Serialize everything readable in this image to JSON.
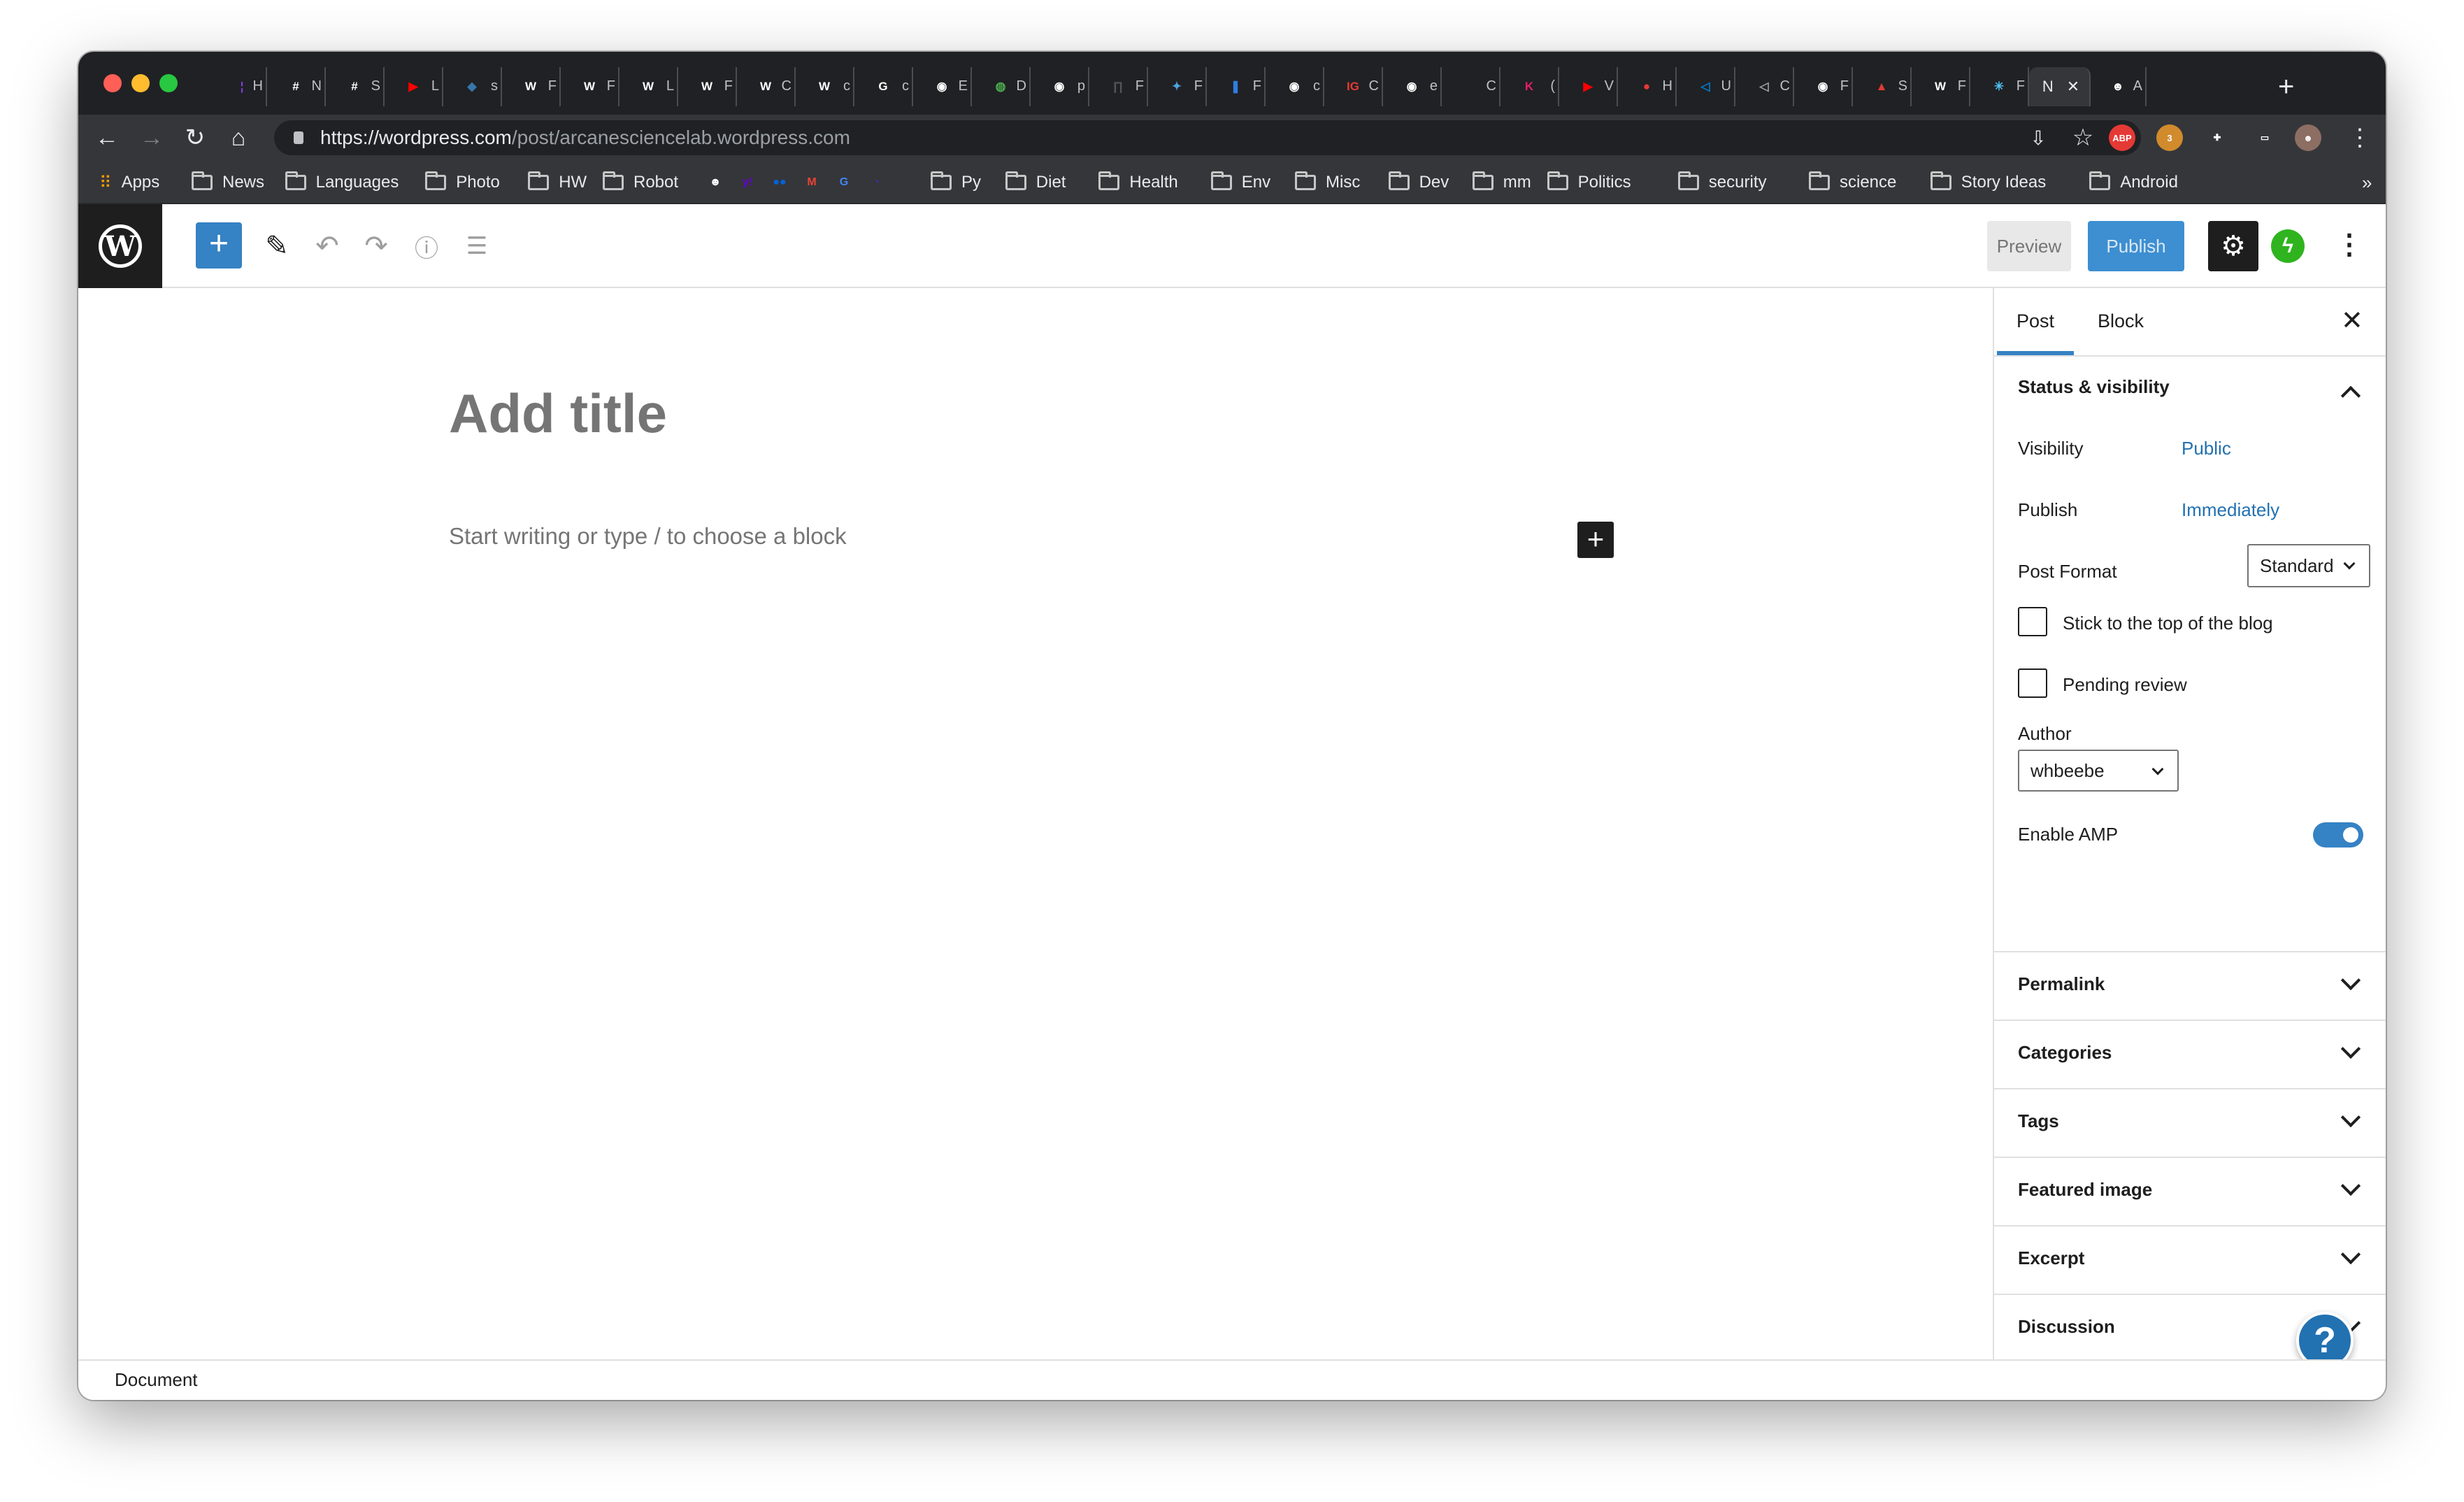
{
  "browser": {
    "tabs": [
      {
        "letter": "H",
        "color": "#7b3fe4",
        "glyph": "¦"
      },
      {
        "letter": "N",
        "color": "#ffffff",
        "glyph": "#"
      },
      {
        "letter": "S",
        "color": "#ffffff",
        "glyph": "#"
      },
      {
        "letter": "L",
        "color": "#ff0000",
        "glyph": "▶"
      },
      {
        "letter": "s",
        "color": "#3776ab",
        "glyph": "◆"
      },
      {
        "letter": "F",
        "color": "#ffffff",
        "glyph": "W"
      },
      {
        "letter": "F",
        "color": "#ffffff",
        "glyph": "W"
      },
      {
        "letter": "L",
        "color": "#ffffff",
        "glyph": "W"
      },
      {
        "letter": "F",
        "color": "#ffffff",
        "glyph": "W"
      },
      {
        "letter": "C",
        "color": "#ffffff",
        "glyph": "W"
      },
      {
        "letter": "c",
        "color": "#ffffff",
        "glyph": "W"
      },
      {
        "letter": "c",
        "color": "#ffffff",
        "glyph": "G"
      },
      {
        "letter": "E",
        "color": "#ffffff",
        "glyph": "◉"
      },
      {
        "letter": "D",
        "color": "#4caf50",
        "glyph": "◍"
      },
      {
        "letter": "p",
        "color": "#ffffff",
        "glyph": "◉"
      },
      {
        "letter": "F",
        "color": "#555555",
        "glyph": "∏"
      },
      {
        "letter": "F",
        "color": "#4aa3df",
        "glyph": "✦"
      },
      {
        "letter": "F",
        "color": "#2f7de1",
        "glyph": "❚"
      },
      {
        "letter": "c",
        "color": "#ffffff",
        "glyph": "◉"
      },
      {
        "letter": "C",
        "color": "#e53935",
        "glyph": "IG"
      },
      {
        "letter": "e",
        "color": "#ffffff",
        "glyph": "◉"
      },
      {
        "letter": "C",
        "color": "#9e9e9e",
        "glyph": ""
      },
      {
        "letter": "(",
        "color": "#e91e63",
        "glyph": "K"
      },
      {
        "letter": "V",
        "color": "#ff0000",
        "glyph": "▶"
      },
      {
        "letter": "H",
        "color": "#e53935",
        "glyph": "●"
      },
      {
        "letter": "U",
        "color": "#007acc",
        "glyph": "◁"
      },
      {
        "letter": "C",
        "color": "#9e9e9e",
        "glyph": "◁"
      },
      {
        "letter": "F",
        "color": "#ffffff",
        "glyph": "◉"
      },
      {
        "letter": "S",
        "color": "#e53935",
        "glyph": "▲"
      },
      {
        "letter": "F",
        "color": "#ffffff",
        "glyph": "W"
      },
      {
        "letter": "F",
        "color": "#4fc3f7",
        "glyph": "✳"
      }
    ],
    "active_tab": {
      "letter": "N",
      "close": "✕"
    },
    "last_tab": {
      "letter": "A",
      "glyph": "☻"
    },
    "new_tab": "+",
    "url": {
      "domain": "https://wordpress.com",
      "path": "/post/arcanesciencelab.wordpress.com"
    },
    "extensions": [
      {
        "name": "abp-icon",
        "label": "ABP",
        "color": "#e53935"
      },
      {
        "name": "extension-badge-icon",
        "label": "3",
        "color": "#d18b2c"
      },
      {
        "name": "puzzle-icon",
        "label": "✚",
        "color": "#35363a"
      },
      {
        "name": "cast-icon",
        "label": "▭",
        "color": "#35363a"
      },
      {
        "name": "profile-avatar",
        "label": "☻",
        "color": "#8d6e63"
      }
    ],
    "bookmarks": [
      {
        "type": "apps",
        "label": "Apps"
      },
      {
        "type": "folder",
        "label": "News"
      },
      {
        "type": "folder",
        "label": "Languages"
      },
      {
        "type": "folder",
        "label": "Photo"
      },
      {
        "type": "folder",
        "label": "HW"
      },
      {
        "type": "folder",
        "label": "Robot"
      },
      {
        "type": "icon",
        "glyph": "☻",
        "color": "#ffffff"
      },
      {
        "type": "icon",
        "glyph": "y!",
        "color": "#6001d2"
      },
      {
        "type": "icon",
        "glyph": "●●",
        "color": "#0063dc"
      },
      {
        "type": "icon",
        "glyph": "M",
        "color": "#ea4335"
      },
      {
        "type": "icon",
        "glyph": "G",
        "color": "#4285f4"
      },
      {
        "type": "icon",
        "glyph": "◔",
        "color": "#3a2ea8"
      },
      {
        "type": "icon",
        "glyph": "",
        "color": "#9e9e9e"
      },
      {
        "type": "folder",
        "label": "Py"
      },
      {
        "type": "folder",
        "label": "Diet"
      },
      {
        "type": "folder",
        "label": "Health"
      },
      {
        "type": "folder",
        "label": "Env"
      },
      {
        "type": "folder",
        "label": "Misc"
      },
      {
        "type": "folder",
        "label": "Dev"
      },
      {
        "type": "folder",
        "label": "mm"
      },
      {
        "type": "folder",
        "label": "Politics"
      },
      {
        "type": "folder",
        "label": "security"
      },
      {
        "type": "folder",
        "label": "science"
      },
      {
        "type": "folder",
        "label": "Story Ideas"
      },
      {
        "type": "folder",
        "label": "Android"
      }
    ],
    "bookmarks_overflow": "»"
  },
  "wp_header": {
    "logo": "W",
    "add_block": "+",
    "preview_label": "Preview",
    "publish_label": "Publish",
    "colors": {
      "accent": "#3582c4",
      "publish_bg": "#3d8fd1",
      "jetpack": "#2fb41f"
    }
  },
  "editor": {
    "title_placeholder": "Add title",
    "body_placeholder": "Start writing or type / to choose a block",
    "inserter": "+"
  },
  "sidebar": {
    "tabs": [
      "Post",
      "Block"
    ],
    "active_tab": "Post",
    "close": "✕",
    "status": {
      "heading": "Status & visibility",
      "visibility_label": "Visibility",
      "visibility_value": "Public",
      "publish_label": "Publish",
      "publish_value": "Immediately",
      "format_label": "Post Format",
      "format_value": "Standard",
      "sticky_label": "Stick to the top of the blog",
      "sticky_checked": false,
      "pending_label": "Pending review",
      "pending_checked": false,
      "author_label": "Author",
      "author_value": "whbeebe",
      "amp_label": "Enable AMP",
      "amp_enabled": true
    },
    "panels": [
      "Permalink",
      "Categories",
      "Tags",
      "Featured image",
      "Excerpt",
      "Discussion"
    ]
  },
  "help_button": "?",
  "footer": {
    "breadcrumb": "Document"
  }
}
